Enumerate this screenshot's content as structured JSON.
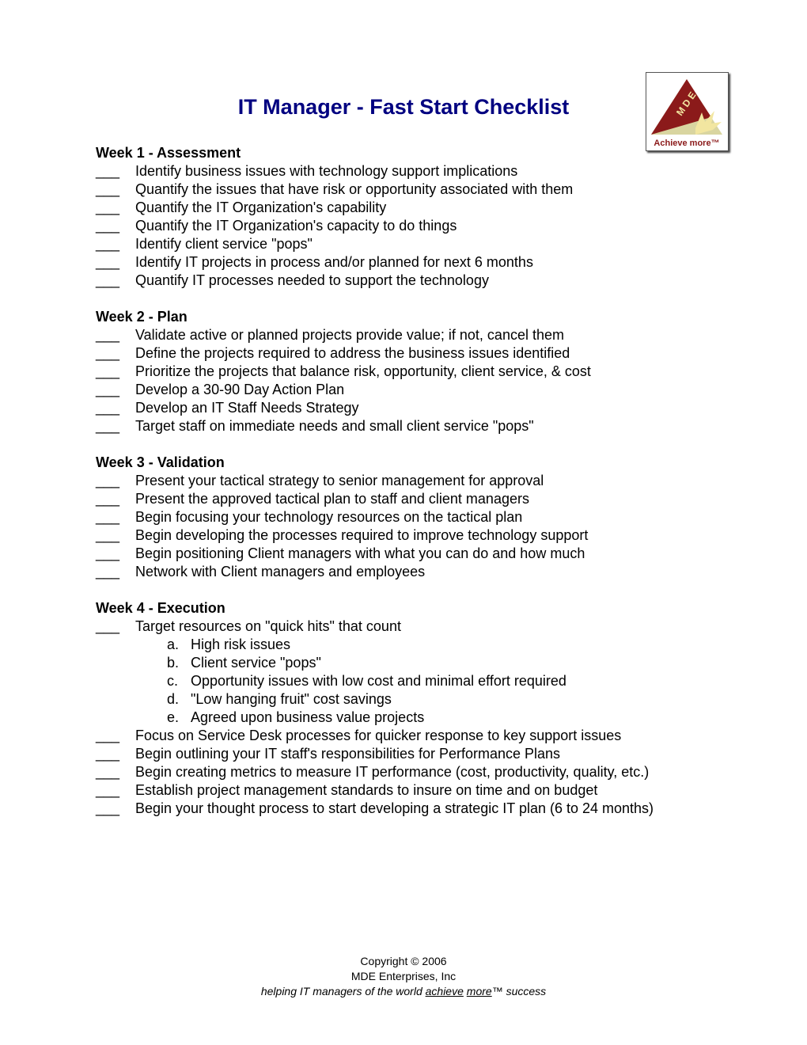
{
  "title": "IT Manager - Fast Start Checklist",
  "logo": {
    "letters": "M D E",
    "caption": "Achieve more™",
    "colors": {
      "triangle": "#8b1a1a",
      "burst": "#f2e6a0",
      "background": "#d9d5a0"
    }
  },
  "blank": "___",
  "sections": [
    {
      "heading": "Week 1 - Assessment",
      "items": [
        {
          "text": "Identify business issues with technology support implications"
        },
        {
          "text": "Quantify the issues that have risk or opportunity associated with them"
        },
        {
          "text": "Quantify the IT Organization's capability"
        },
        {
          "text": "Quantify the IT Organization's capacity to do things"
        },
        {
          "text": "Identify client service \"pops\""
        },
        {
          "text": "Identify IT projects in process and/or planned for next 6 months"
        },
        {
          "text": "Quantify IT processes needed to support the technology"
        }
      ]
    },
    {
      "heading": "Week 2 - Plan",
      "items": [
        {
          "text": "Validate active or planned projects provide value; if not, cancel them"
        },
        {
          "text": "Define the projects required to address the business issues identified"
        },
        {
          "text": "Prioritize the projects that balance risk, opportunity, client service, & cost"
        },
        {
          "text": "Develop a 30-90 Day Action Plan"
        },
        {
          "text": "Develop an IT Staff Needs Strategy"
        },
        {
          "text": "Target staff on immediate needs and small client service \"pops\""
        }
      ]
    },
    {
      "heading": "Week 3 - Validation",
      "items": [
        {
          "text": "Present your tactical strategy to senior management for approval"
        },
        {
          "text": "Present the approved tactical plan to staff and client managers"
        },
        {
          "text": "Begin focusing your technology resources on the tactical plan"
        },
        {
          "text": "Begin developing the processes required to improve technology support"
        },
        {
          "text": "Begin positioning Client managers with what you can do and how much"
        },
        {
          "text": "Network with Client managers and employees"
        }
      ]
    },
    {
      "heading": "Week 4 - Execution",
      "items": [
        {
          "text": "Target resources on \"quick hits\" that count",
          "subitems": [
            {
              "label": "a.",
              "text": "High risk issues"
            },
            {
              "label": "b.",
              "text": "Client service \"pops\""
            },
            {
              "label": "c.",
              "text": "Opportunity issues with low cost and minimal effort required"
            },
            {
              "label": "d.",
              "text": "\"Low hanging fruit\" cost savings"
            },
            {
              "label": "e.",
              "text": "Agreed upon business value projects"
            }
          ]
        },
        {
          "text": "Focus on Service Desk processes for quicker response to key support issues"
        },
        {
          "text": "Begin outlining your IT staff's responsibilities for Performance Plans"
        },
        {
          "text": "Begin creating metrics to measure IT performance (cost, productivity, quality, etc.)"
        },
        {
          "text": "Establish project management standards to insure on time and on budget"
        },
        {
          "text": "Begin your thought process to start developing a strategic IT plan (6 to 24 months)"
        }
      ]
    }
  ],
  "footer": {
    "copyright": "Copyright © 2006",
    "company": "MDE Enterprises, Inc",
    "tagline_pre": "helping IT managers of the world ",
    "tagline_u1": "achieve",
    "tagline_u2": "more",
    "tagline_post": "™  success"
  }
}
